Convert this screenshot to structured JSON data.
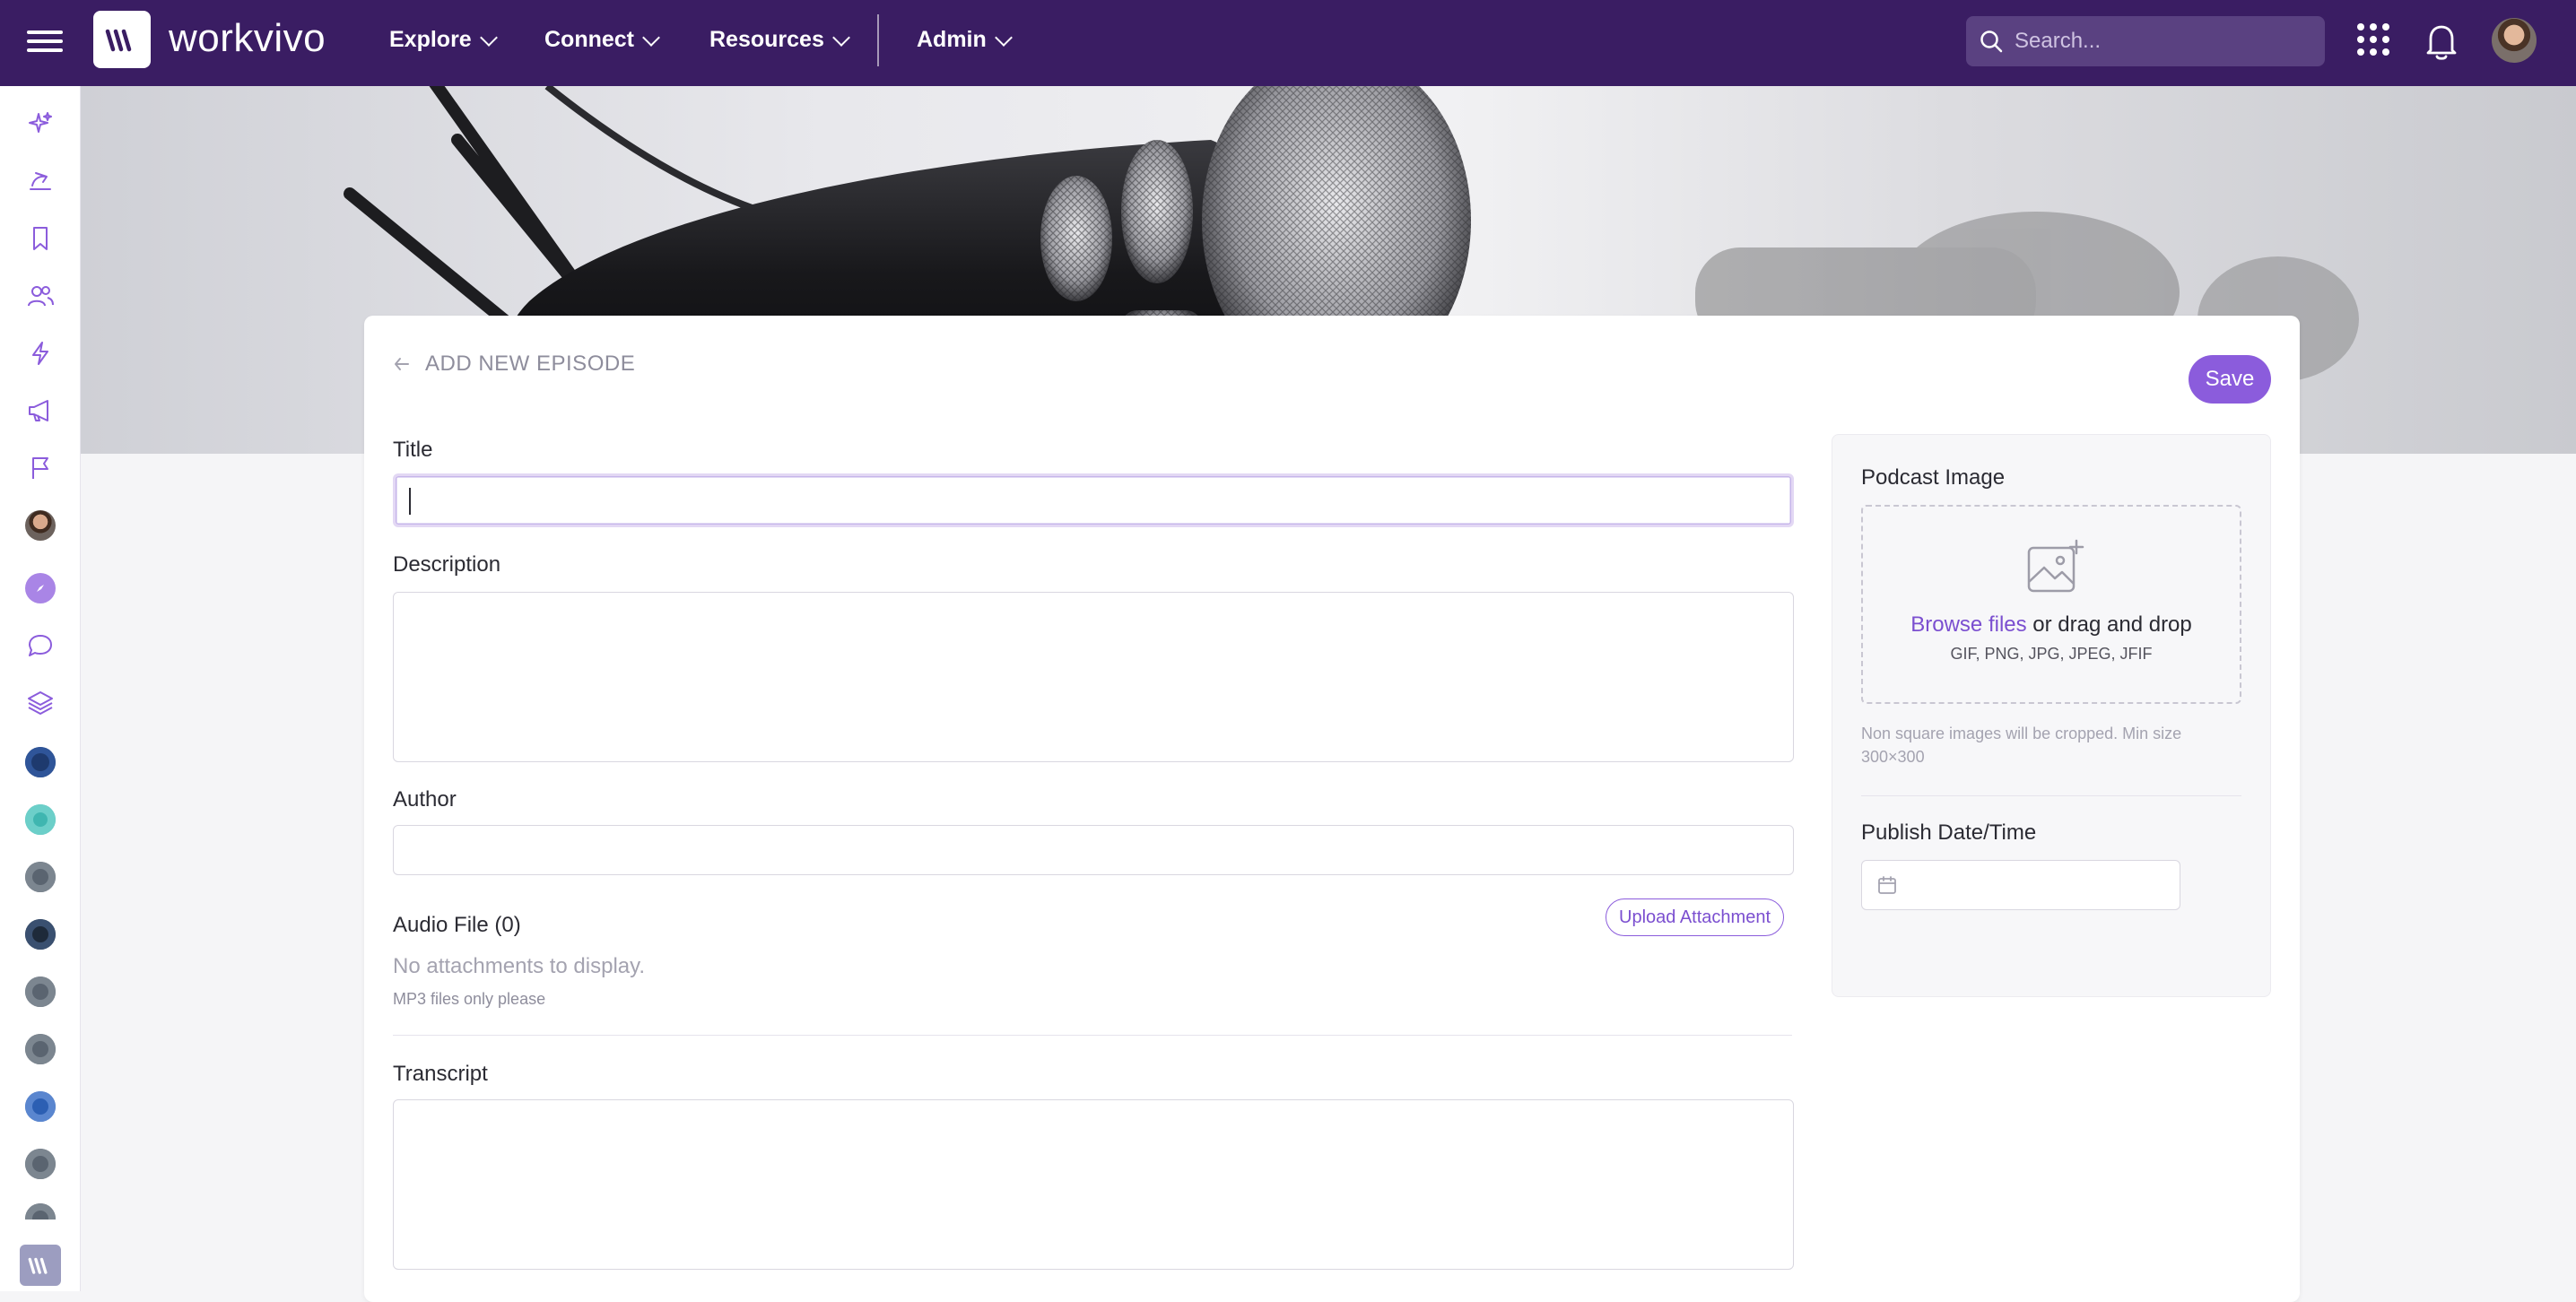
{
  "app": {
    "brand": "workvivo",
    "accent": "#8b5cdc",
    "nav_bg": "#3a1d63"
  },
  "nav": {
    "items": [
      {
        "label": "Explore"
      },
      {
        "label": "Connect"
      },
      {
        "label": "Resources"
      },
      {
        "label": "Admin"
      }
    ],
    "search_placeholder": "Search...",
    "icons": [
      "menu-icon",
      "apps-grid-icon",
      "bell-icon",
      "user-avatar"
    ]
  },
  "rail": {
    "icons": [
      "sparkle-icon",
      "feed-icon",
      "bookmark-icon",
      "people-icon",
      "bolt-icon",
      "megaphone-icon",
      "flag-icon",
      "avatar",
      "compass-icon",
      "chat-icon",
      "layers-icon",
      "space-avatar",
      "space-avatar",
      "space-avatar",
      "space-avatar",
      "space-avatar",
      "space-avatar",
      "space-avatar",
      "space-avatar",
      "space-avatar",
      "workvivo-logo"
    ]
  },
  "page": {
    "back_label": "ADD NEW EPISODE",
    "save_label": "Save"
  },
  "form": {
    "title_label": "Title",
    "title_value": "",
    "description_label": "Description",
    "description_value": "",
    "author_label": "Author",
    "author_value": "",
    "audio_label": "Audio File (0)",
    "upload_label": "Upload Attachment",
    "no_attachments": "No attachments to display.",
    "mp3_note": "MP3 files only please",
    "transcript_label": "Transcript",
    "transcript_value": ""
  },
  "side": {
    "image_label": "Podcast Image",
    "browse_link": "Browse files",
    "browse_rest": " or drag and drop",
    "file_types": "GIF, PNG, JPG, JPEG, JFIF",
    "crop_note_1": "Non square images will be cropped. Min size",
    "crop_note_2": "300×300",
    "publish_label": "Publish Date/Time",
    "publish_value": ""
  }
}
